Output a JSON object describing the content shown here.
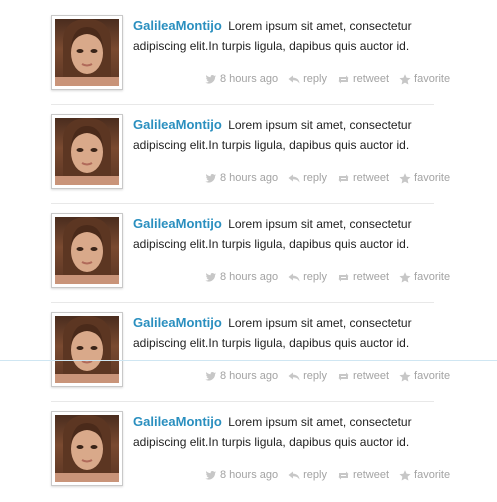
{
  "tweets": [
    {
      "user": "GalileaMontijo",
      "text": "Lorem ipsum  sit amet, consectetur adipiscing elit.In turpis ligula, dapibus quis auctor id.",
      "time": "8 hours ago",
      "reply": "reply",
      "retweet": "retweet",
      "favorite": "favorite"
    },
    {
      "user": "GalileaMontijo",
      "text": "Lorem ipsum  sit amet, consectetur adipiscing elit.In turpis ligula, dapibus quis auctor id.",
      "time": "8 hours ago",
      "reply": "reply",
      "retweet": "retweet",
      "favorite": "favorite"
    },
    {
      "user": "GalileaMontijo",
      "text": "Lorem ipsum  sit amet, consectetur adipiscing elit.In turpis ligula, dapibus quis auctor id.",
      "time": "8 hours ago",
      "reply": "reply",
      "retweet": "retweet",
      "favorite": "favorite"
    },
    {
      "user": "GalileaMontijo",
      "text": "Lorem ipsum  sit amet, consectetur adipiscing elit.In turpis ligula, dapibus quis auctor id.",
      "time": "8 hours ago",
      "reply": "reply",
      "retweet": "retweet",
      "favorite": "favorite"
    },
    {
      "user": "GalileaMontijo",
      "text": "Lorem ipsum  sit amet, consectetur adipiscing elit.In turpis ligula, dapibus quis auctor id.",
      "time": "8 hours ago",
      "reply": "reply",
      "retweet": "retweet",
      "favorite": "favorite"
    }
  ],
  "colors": {
    "username": "#2a8fbf",
    "meta": "#a3a3a3",
    "text": "#222222",
    "separator": "#e8e8e8"
  },
  "icons": {
    "time": "bird-icon",
    "reply": "reply-arrow-icon",
    "retweet": "retweet-icon",
    "favorite": "star-icon"
  }
}
